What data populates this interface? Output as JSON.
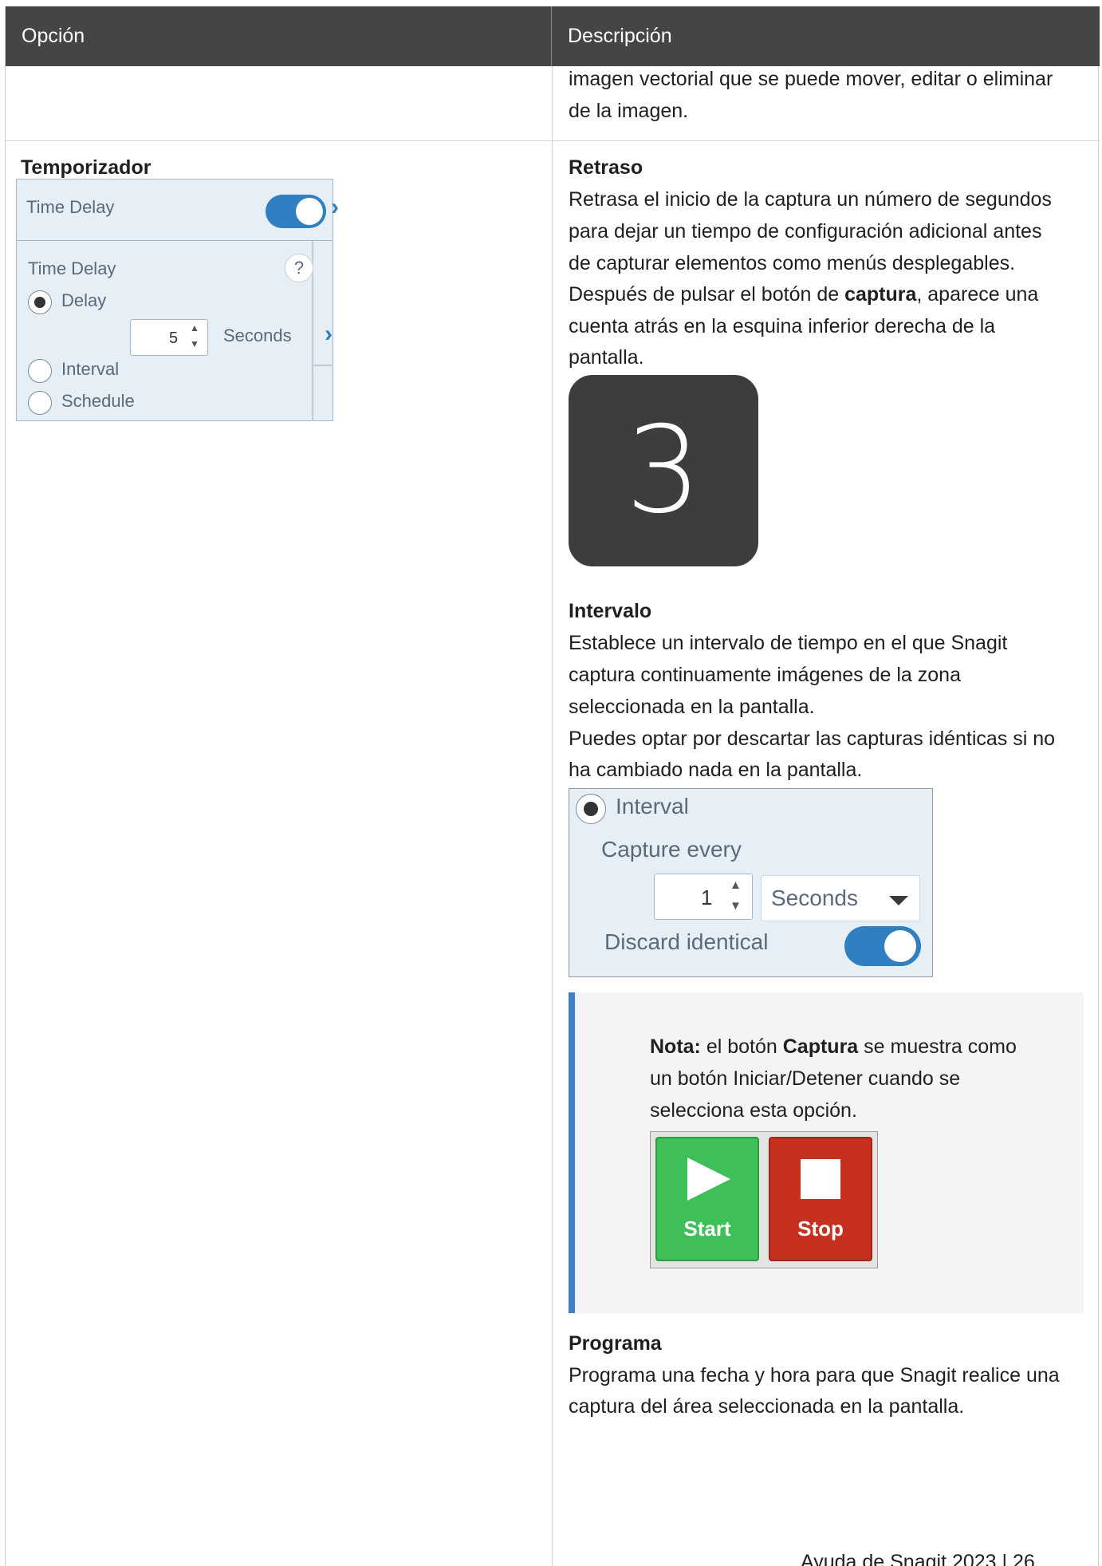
{
  "table": {
    "headers": {
      "option": "Opción",
      "description": "Descripción"
    }
  },
  "prev_row": {
    "line1": "imagen vectorial que se puede mover, editar o eliminar",
    "line2": "de la imagen."
  },
  "timer_row": {
    "option_title": "Temporizador",
    "widget": {
      "header_title": "Time Delay",
      "toggle_on": true,
      "panel_title": "Time Delay",
      "help": "?",
      "option_delay": "Delay",
      "delay_value": "5",
      "delay_unit": "Seconds",
      "option_interval": "Interval",
      "option_schedule": "Schedule",
      "selected": "Delay"
    },
    "delay": {
      "title": "Retraso",
      "lines": [
        "Retrasa el inicio de la captura un número de segundos",
        "para dejar un tiempo de configuración adicional antes",
        "de capturar elementos como menús desplegables."
      ],
      "line4_pre": "Después de pulsar el botón de ",
      "line4_bold": "captura",
      "line4_post": ", aparece una",
      "line5": "cuenta atrás en la esquina inferior derecha de la",
      "line6": "pantalla.",
      "countdown": "3"
    },
    "interval": {
      "title": "Intervalo",
      "lines": [
        "Establece un intervalo de tiempo en el que Snagit",
        "captura continuamente imágenes de la zona",
        "seleccionada en la pantalla.",
        "Puedes optar por descartar las capturas idénticas si no",
        "ha cambiado nada en la pantalla."
      ],
      "widget": {
        "option": "Interval",
        "capture_every": "Capture every",
        "value": "1",
        "unit": "Seconds",
        "discard": "Discard identical",
        "discard_on": true
      }
    },
    "note": {
      "label": "Nota:",
      "t1": " el botón ",
      "bold2": "Captura",
      "t2": " se muestra como",
      "line2": "un botón Iniciar/Detener cuando se",
      "line3": "selecciona esta opción.",
      "start": "Start",
      "stop": "Stop"
    },
    "schedule": {
      "title": "Programa",
      "lines": [
        "Programa una fecha y hora para que Snagit realice una",
        "captura del área seleccionada en la pantalla."
      ]
    }
  },
  "footer": "Ayuda de Snagit 2023 | 26"
}
